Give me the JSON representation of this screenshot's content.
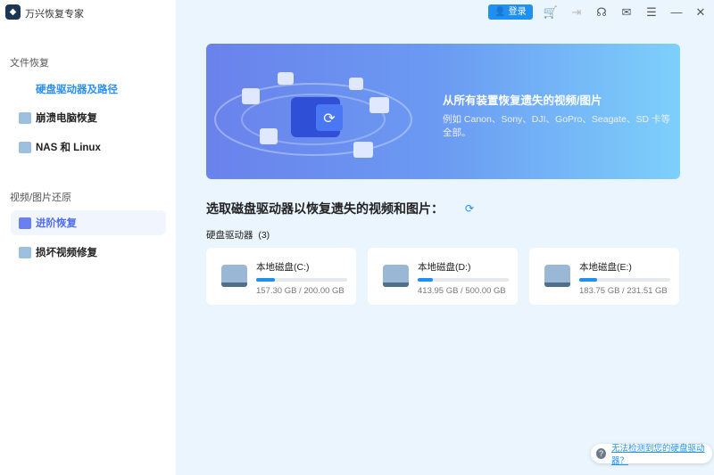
{
  "app": {
    "title": "万兴恢复专家"
  },
  "topbar": {
    "login_label": "登录",
    "icons": [
      "cart-icon",
      "export-icon",
      "headset-icon",
      "mail-icon",
      "menu-icon",
      "minimize-icon",
      "close-icon"
    ]
  },
  "sidebar": {
    "sections": [
      {
        "label": "文件恢复",
        "items": [
          {
            "label": "硬盘驱动器及路径"
          },
          {
            "label": "崩溃电脑恢复"
          },
          {
            "label": "NAS 和 Linux"
          }
        ]
      },
      {
        "label": "视频/图片还原",
        "items": [
          {
            "label": "进阶恢复"
          },
          {
            "label": "损坏视频修复"
          }
        ]
      }
    ]
  },
  "banner": {
    "title": "从所有装置恢复遗失的视频/图片",
    "desc": "例如 Canon、Sony、DJI、GoPro、Seagate、SD 卡等全部。"
  },
  "main": {
    "heading": "选取磁盘驱动器以恢复遗失的视频和图片：",
    "drives_label": "硬盘驱动器",
    "drives_count": "(3)",
    "drives": [
      {
        "name": "本地磁盘(C:)",
        "size": "157.30 GB / 200.00 GB",
        "fill_percent": 21
      },
      {
        "name": "本地磁盘(D:)",
        "size": "413.95 GB / 500.00 GB",
        "fill_percent": 17
      },
      {
        "name": "本地磁盘(E:)",
        "size": "183.75 GB / 231.51 GB",
        "fill_percent": 20
      }
    ]
  },
  "help": {
    "label": "无法检测到您的硬盘驱动器？"
  },
  "colors": {
    "accent": "#1f8ff0",
    "active": "#4f6bf5",
    "cart": "#f07d1a"
  }
}
